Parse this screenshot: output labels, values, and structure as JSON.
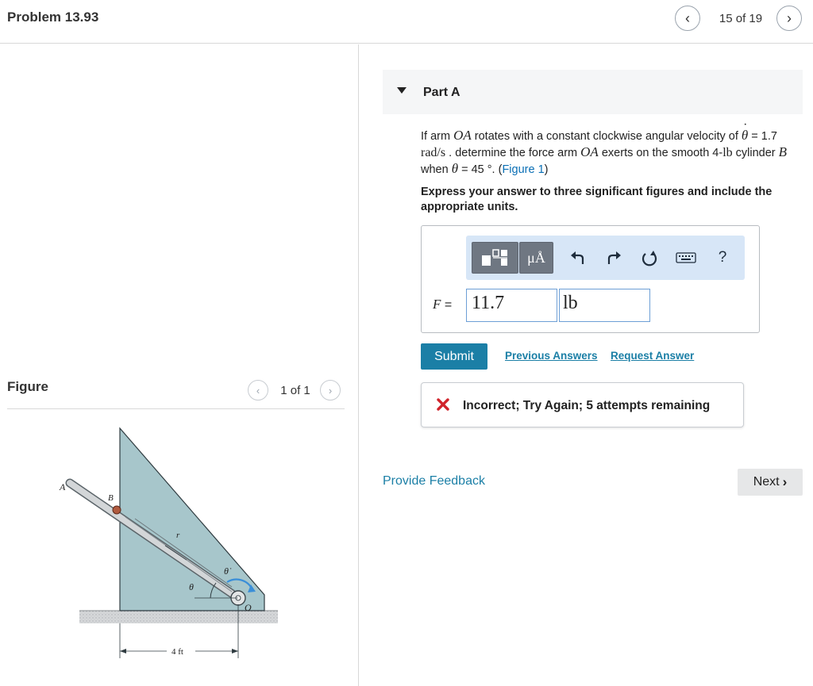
{
  "header": {
    "problem_title": "Problem 13.93",
    "page_count": "15 of 19"
  },
  "figure": {
    "label": "Figure",
    "count": "1 of 1",
    "labels": {
      "A": "A",
      "B": "B",
      "r": "r",
      "theta_dot": "θ̇",
      "theta": "θ",
      "O": "O",
      "dim": "4 ft"
    }
  },
  "part": {
    "title": "Part A"
  },
  "question": {
    "t1": "If arm ",
    "oa": "OA",
    "t2": " rotates with a constant clockwise angular velocity of ",
    "theta": "θ",
    "t3": " = 1.7 ",
    "rad": "rad/s",
    "t4": " . determine the force arm ",
    "oa2": "OA",
    "t5": " exerts on the smooth 4-",
    "lb": "lb",
    "t6": " cylinder ",
    "b": "B",
    "t7": " when ",
    "theta2": "θ",
    "t8": " = 45 °. (",
    "fig_link": "Figure 1",
    "t9": ")"
  },
  "instruction": "Express your answer to three significant figures and include the appropriate units.",
  "answer": {
    "var": "F",
    "eq": " =",
    "value": "11.7",
    "unit": "lb"
  },
  "toolbar": {
    "units_label": "μÅ",
    "help_label": "?"
  },
  "actions": {
    "submit_label": "Submit",
    "previous_answers_label": "Previous Answers",
    "request_answer_label": "Request Answer"
  },
  "feedback": {
    "message": "Incorrect; Try Again; 5 attempts remaining"
  },
  "footer": {
    "provide_feedback_label": "Provide Feedback",
    "next_label": "Next"
  }
}
